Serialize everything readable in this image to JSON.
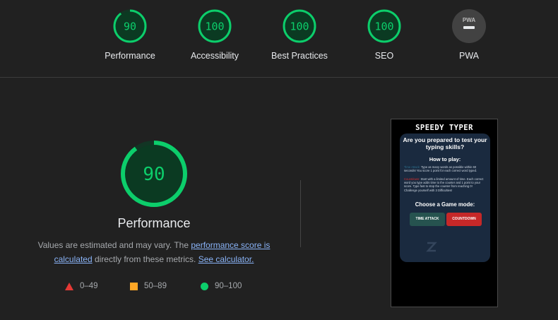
{
  "colors": {
    "pass": "#0cce6b",
    "average": "#ffa726",
    "fail": "#e53935",
    "na": "#757575"
  },
  "top_gauges": [
    {
      "label": "Performance",
      "score": "90",
      "value": 90
    },
    {
      "label": "Accessibility",
      "score": "100",
      "value": 100
    },
    {
      "label": "Best Practices",
      "score": "100",
      "value": 100
    },
    {
      "label": "SEO",
      "score": "100",
      "value": 100
    },
    {
      "label": "PWA",
      "badge": "PWA",
      "icon": "pwa-dash-icon"
    }
  ],
  "main": {
    "score": "90",
    "value": 90,
    "title": "Performance",
    "desc_pre": "Values are estimated and may vary. The ",
    "desc_link1": "performance score is calculated",
    "desc_mid": " directly from these metrics. ",
    "desc_link2": "See calculator."
  },
  "legend": [
    {
      "range": "0–49",
      "icon": "triangle-icon"
    },
    {
      "range": "50–89",
      "icon": "square-icon"
    },
    {
      "range": "90–100",
      "icon": "circle-icon"
    }
  ],
  "thumbnail": {
    "title": "SPEEDY TYPER",
    "question": "Are you prepared to test your typing skills?",
    "how_to_play": "How to play:",
    "time_attack_label": "Time Attack:",
    "time_attack_text": " Type as many words as possible within 60 seconds! You score 1 point for each correct word typed.",
    "countdown_label": "Countdown:",
    "countdown_text": " Start with a limited amount of time. Each correct word you type adds time to the counter and 1 point to your score. Type fast to stop the counter from reaching 0! Challenge yourself with 3 Difficulties!",
    "choose_mode": "Choose a Game mode:",
    "btn_time_attack": "TIME ATTACK",
    "btn_countdown": "COUNTDOWN"
  }
}
